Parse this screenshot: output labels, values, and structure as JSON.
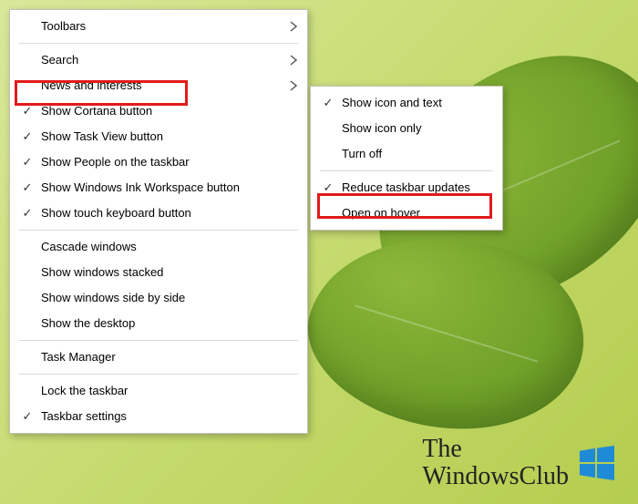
{
  "main_menu": {
    "groups": [
      {
        "items": [
          {
            "label": "Toolbars",
            "checked": false,
            "submenu": true,
            "name": "menu-toolbars"
          }
        ]
      },
      {
        "items": [
          {
            "label": "Search",
            "checked": false,
            "submenu": true,
            "name": "menu-search"
          },
          {
            "label": "News and interests",
            "checked": false,
            "submenu": true,
            "name": "menu-news-and-interests",
            "highlighted": true
          },
          {
            "label": "Show Cortana button",
            "checked": true,
            "submenu": false,
            "name": "menu-show-cortana-button"
          },
          {
            "label": "Show Task View button",
            "checked": true,
            "submenu": false,
            "name": "menu-show-task-view-button"
          },
          {
            "label": "Show People on the taskbar",
            "checked": true,
            "submenu": false,
            "name": "menu-show-people-on-the-taskbar"
          },
          {
            "label": "Show Windows Ink Workspace button",
            "checked": true,
            "submenu": false,
            "name": "menu-show-windows-ink-workspace-button"
          },
          {
            "label": "Show touch keyboard button",
            "checked": true,
            "submenu": false,
            "name": "menu-show-touch-keyboard-button"
          }
        ]
      },
      {
        "items": [
          {
            "label": "Cascade windows",
            "checked": false,
            "submenu": false,
            "name": "menu-cascade-windows"
          },
          {
            "label": "Show windows stacked",
            "checked": false,
            "submenu": false,
            "name": "menu-show-windows-stacked"
          },
          {
            "label": "Show windows side by side",
            "checked": false,
            "submenu": false,
            "name": "menu-show-windows-side-by-side"
          },
          {
            "label": "Show the desktop",
            "checked": false,
            "submenu": false,
            "name": "menu-show-the-desktop"
          }
        ]
      },
      {
        "items": [
          {
            "label": "Task Manager",
            "checked": false,
            "submenu": false,
            "name": "menu-task-manager"
          }
        ]
      },
      {
        "items": [
          {
            "label": "Lock the taskbar",
            "checked": false,
            "submenu": false,
            "name": "menu-lock-the-taskbar"
          },
          {
            "label": "Taskbar settings",
            "checked": true,
            "submenu": false,
            "name": "menu-taskbar-settings"
          }
        ]
      }
    ]
  },
  "sub_menu": {
    "groups": [
      {
        "items": [
          {
            "label": "Show icon and text",
            "checked": true,
            "submenu": false,
            "name": "submenu-show-icon-and-text"
          },
          {
            "label": "Show icon only",
            "checked": false,
            "submenu": false,
            "name": "submenu-show-icon-only"
          },
          {
            "label": "Turn off",
            "checked": false,
            "submenu": false,
            "name": "submenu-turn-off"
          }
        ]
      },
      {
        "items": [
          {
            "label": "Reduce taskbar updates",
            "checked": true,
            "submenu": false,
            "name": "submenu-reduce-taskbar-updates",
            "highlighted": true
          },
          {
            "label": "Open on hover",
            "checked": false,
            "submenu": false,
            "name": "submenu-open-on-hover"
          }
        ]
      }
    ]
  },
  "watermark": {
    "line1": "The",
    "line2": "WindowsClub"
  }
}
